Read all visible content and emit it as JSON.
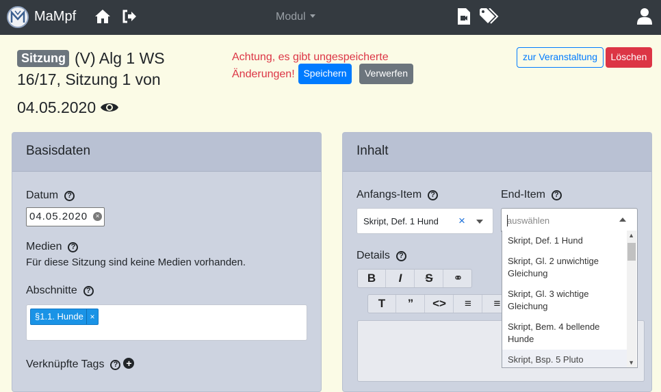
{
  "navbar": {
    "brand": "MaMpf",
    "module_label": "Modul"
  },
  "header": {
    "type_badge": "Sitzung",
    "title": "(V) Alg 1 WS 16/17, Sitzung 1 von",
    "date": "04.05.2020",
    "warning": "Achtung, es gibt ungespeicherte Änderungen!",
    "save_label": "Speichern",
    "discard_label": "Verwerfen",
    "course_label": "zur Veranstaltung",
    "delete_label": "Löschen"
  },
  "basics": {
    "title": "Basisdaten",
    "date_label": "Datum",
    "date_value": "04.05.2020",
    "media_label": "Medien",
    "media_text": "Für diese Sitzung sind keine Medien vorhanden.",
    "sections_label": "Abschnitte",
    "section_tag": "§1.1. Hunde",
    "tags_label": "Verknüpfte Tags"
  },
  "content": {
    "title": "Inhalt",
    "start_label": "Anfangs-Item",
    "start_value": "Skript, Def. 1 Hund",
    "end_label": "End-Item",
    "end_placeholder": "auswählen",
    "details_label": "Details",
    "dropdown_items": [
      "Skript, Def. 1 Hund",
      "Skript, Gl. 2 unwichtige Gleichung",
      "Skript, Gl. 3 wichtige Gleichung",
      "Skript, Bem. 4 bellende Hunde",
      "Skript, Bsp. 5 Pluto"
    ]
  },
  "colors": {
    "navbar": "#343a40",
    "background": "#fbfbe6",
    "primary": "#007bff",
    "danger": "#dc3545",
    "secondary": "#6c757d"
  }
}
